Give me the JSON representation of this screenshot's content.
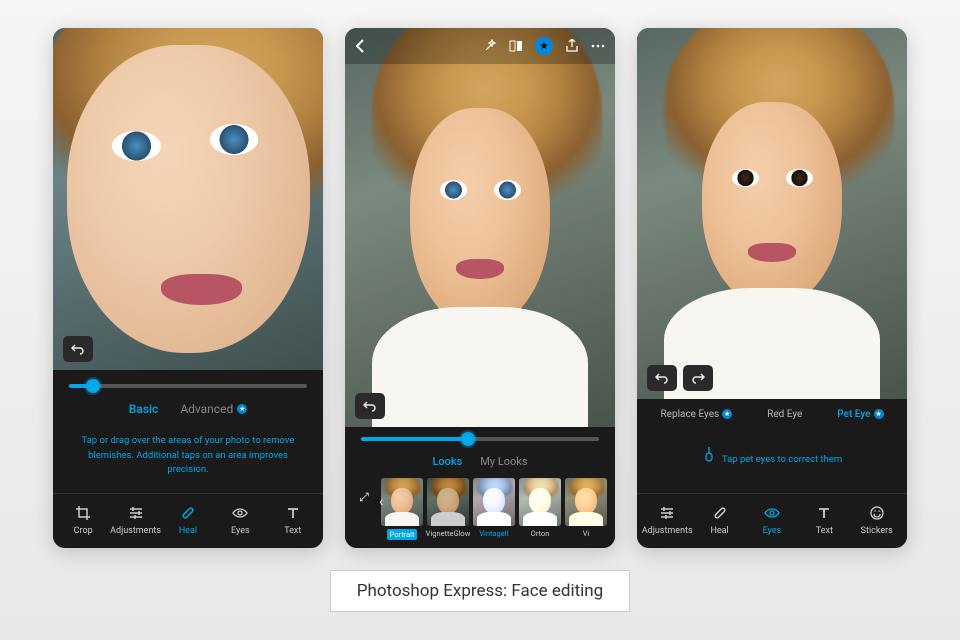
{
  "caption": "Photoshop Express: Face editing",
  "accent": "#00a8e8",
  "screen1": {
    "slider_value": 10,
    "tabs": {
      "basic": "Basic",
      "advanced": "Advanced"
    },
    "active_tab": "basic",
    "hint": "Tap or drag over the areas of your photo to remove blemishes. Additional taps on an area improves precision.",
    "nav": [
      {
        "id": "crop",
        "label": "Crop"
      },
      {
        "id": "adjustments",
        "label": "Adjustments"
      },
      {
        "id": "heal",
        "label": "Heal"
      },
      {
        "id": "eyes",
        "label": "Eyes"
      },
      {
        "id": "text",
        "label": "Text"
      }
    ],
    "active_nav": "heal"
  },
  "screen2": {
    "slider_value": 45,
    "tabs": {
      "looks": "Looks",
      "mylooks": "My Looks"
    },
    "active_tab": "looks",
    "looks": [
      {
        "id": "portrait",
        "label": "Portrait"
      },
      {
        "id": "vignetteglow",
        "label": "VignetteGlow"
      },
      {
        "id": "vintageii",
        "label": "VintageII"
      },
      {
        "id": "orton",
        "label": "Orton"
      },
      {
        "id": "vignette",
        "label": "Vi"
      }
    ],
    "active_look": "portrait"
  },
  "screen3": {
    "modes": [
      {
        "id": "replace",
        "label": "Replace Eyes"
      },
      {
        "id": "redeye",
        "label": "Red Eye"
      },
      {
        "id": "peteye",
        "label": "Pet Eye"
      }
    ],
    "active_mode": "peteye",
    "hint": "Tap pet eyes to correct them",
    "nav": [
      {
        "id": "adjustments",
        "label": "Adjustments"
      },
      {
        "id": "heal",
        "label": "Heal"
      },
      {
        "id": "eyes",
        "label": "Eyes"
      },
      {
        "id": "text",
        "label": "Text"
      },
      {
        "id": "stickers",
        "label": "Stickers"
      }
    ],
    "active_nav": "eyes"
  }
}
